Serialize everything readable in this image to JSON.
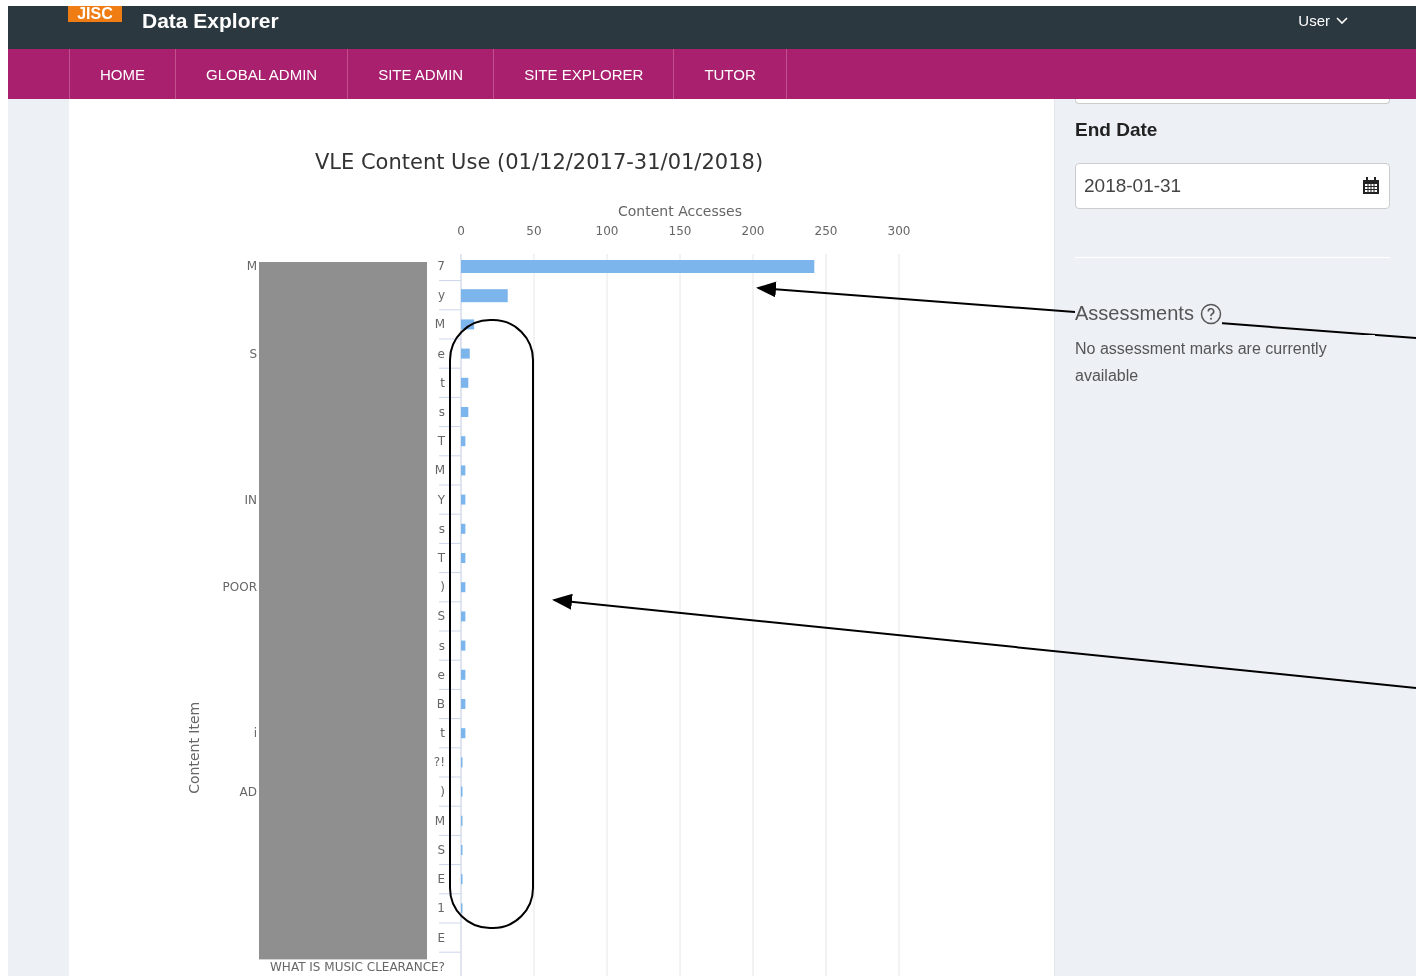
{
  "header": {
    "logo": "JISC",
    "title": "Data Explorer",
    "user_menu": "User"
  },
  "nav": [
    "HOME",
    "GLOBAL ADMIN",
    "SITE ADMIN",
    "SITE EXPLORER",
    "TUTOR"
  ],
  "chart": {
    "chart_data": {
      "type": "bar",
      "orientation": "horizontal",
      "grid": true,
      "title": "VLE Content Use (01/12/2017-31/01/2018)",
      "xlabel": "Content Accesses",
      "ylabel": "Content Item",
      "categories": [
        "7",
        "y",
        "M",
        "e",
        "t",
        "s",
        "T",
        "M",
        "Y",
        "s",
        "T",
        ")",
        "S",
        "s",
        "e",
        "B",
        "t",
        "?!",
        ")",
        "M",
        "S",
        "E",
        "1",
        "E",
        "WHAT IS MUSIC CLEARANCE?"
      ],
      "series": [
        {
          "color": "#7cb5ec",
          "values": [
            242,
            32,
            9,
            6,
            5,
            5,
            3,
            3,
            3,
            3,
            3,
            3,
            3,
            3,
            3,
            3,
            3,
            1,
            1,
            1,
            1,
            1,
            1,
            0,
            0
          ]
        }
      ],
      "xlim": [
        0,
        300
      ],
      "xticks": [
        0,
        50,
        100,
        150,
        200,
        250,
        300
      ]
    },
    "label_stubs": [
      {
        "has_stub": true,
        "text": "M"
      },
      {
        "has_stub": false
      },
      {
        "has_stub": false
      },
      {
        "has_stub": true,
        "text": "S"
      },
      {
        "has_stub": false
      },
      {
        "has_stub": false
      },
      {
        "has_stub": false
      },
      {
        "has_stub": false
      },
      {
        "has_stub": true,
        "text": "IN"
      },
      {
        "has_stub": false
      },
      {
        "has_stub": false
      },
      {
        "has_stub": true,
        "text": "POOR"
      },
      {
        "has_stub": false
      },
      {
        "has_stub": false
      },
      {
        "has_stub": false
      },
      {
        "has_stub": false
      },
      {
        "has_stub": true,
        "text": "i"
      },
      {
        "has_stub": false
      },
      {
        "has_stub": true,
        "text": "AD"
      },
      {
        "has_stub": false
      },
      {
        "has_stub": false
      },
      {
        "has_stub": false
      },
      {
        "has_stub": false
      },
      {
        "has_stub": false
      },
      {
        "has_stub": false
      }
    ]
  },
  "sidebar": {
    "end_date_label": "End Date",
    "end_date_value": "2018-01-31",
    "assessments_title": "Assessments",
    "assessments_message": "No assessment marks are currently available"
  }
}
